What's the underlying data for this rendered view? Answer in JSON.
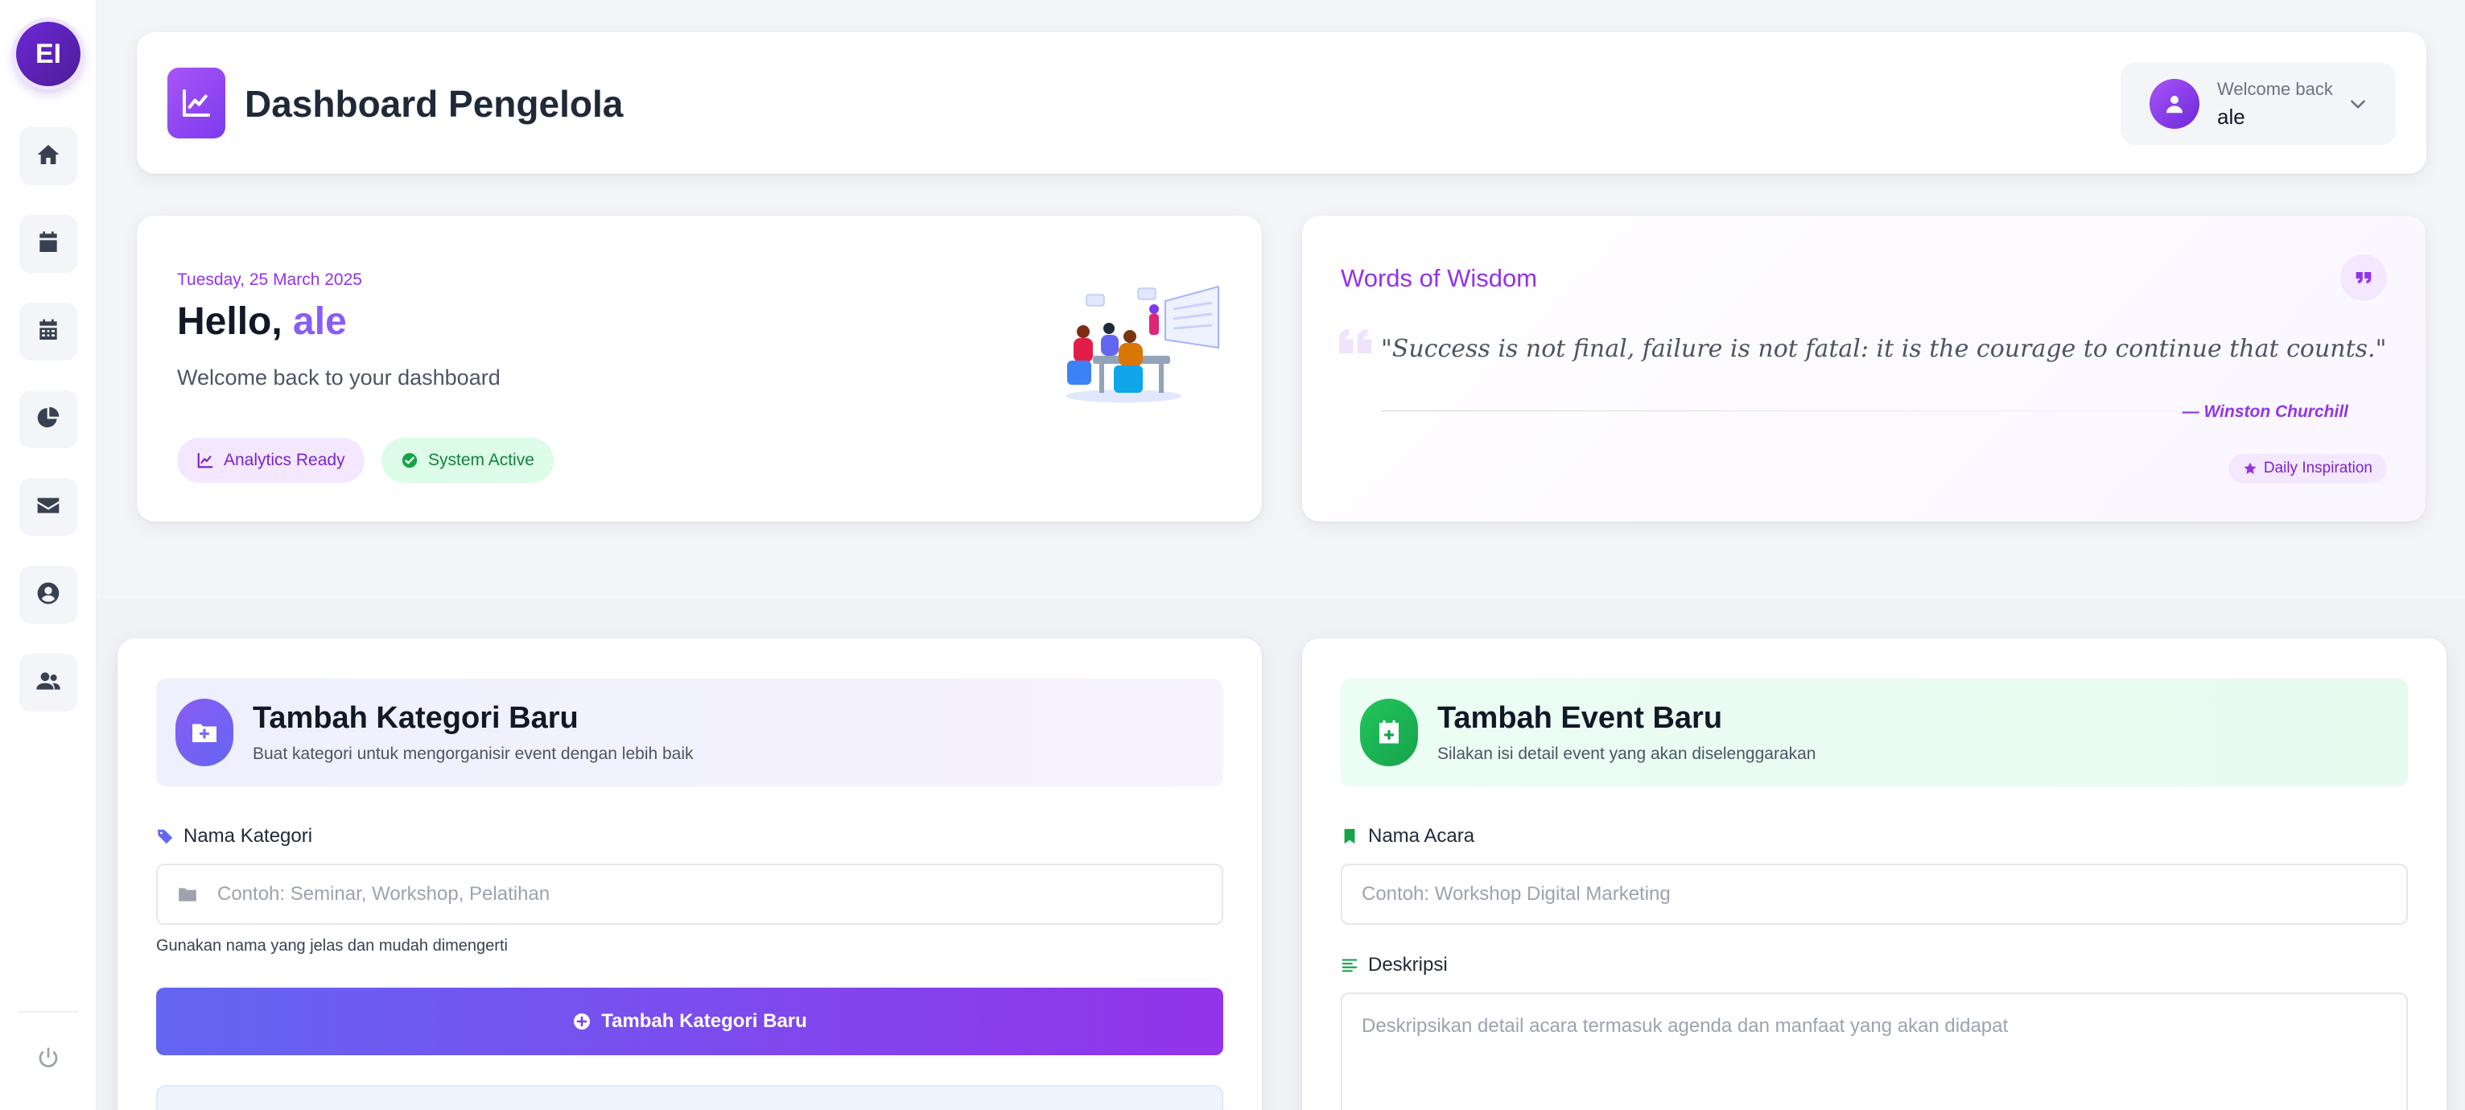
{
  "sidebar": {
    "logo_text": "EI",
    "items": [
      {
        "name": "home",
        "icon": "home-icon"
      },
      {
        "name": "calendar",
        "icon": "calendar-icon"
      },
      {
        "name": "calendar-grid",
        "icon": "calendar-grid-icon"
      },
      {
        "name": "reports",
        "icon": "pie-chart-icon"
      },
      {
        "name": "messages",
        "icon": "envelope-icon"
      },
      {
        "name": "profile",
        "icon": "user-circle-icon"
      },
      {
        "name": "users",
        "icon": "users-icon"
      }
    ],
    "logout_icon": "power-icon"
  },
  "header": {
    "title": "Dashboard Pengelola",
    "welcome_label": "Welcome back",
    "username": "ale"
  },
  "hello_card": {
    "date": "Tuesday, 25 March 2025",
    "greeting": "Hello,",
    "name": "ale",
    "subtitle": "Welcome back to your dashboard",
    "badges": [
      "Analytics Ready",
      "System Active"
    ]
  },
  "wisdom": {
    "title": "Words of Wisdom",
    "quote": "\"Success is not final, failure is not fatal: it is the courage to continue that counts.\"",
    "author": "— Winston Churchill",
    "badge": "Daily Inspiration"
  },
  "category_form": {
    "title": "Tambah Kategori Baru",
    "subtitle": "Buat kategori untuk mengorganisir event dengan lebih baik",
    "field_label": "Nama Kategori",
    "placeholder": "Contoh: Seminar, Workshop, Pelatihan",
    "hint": "Gunakan nama yang jelas dan mudah dimengerti",
    "submit_label": "Tambah Kategori Baru"
  },
  "event_form": {
    "title": "Tambah Event Baru",
    "subtitle": "Silakan isi detail event yang akan diselenggarakan",
    "name_label": "Nama Acara",
    "name_placeholder": "Contoh: Workshop Digital Marketing",
    "desc_label": "Deskripsi",
    "desc_placeholder": "Deskripsikan detail acara termasuk agenda dan manfaat yang akan didapat"
  },
  "colors": {
    "accent": "#8b5cf6",
    "accent_dark": "#6d28d9",
    "success": "#22c55e",
    "background": "#f4f5f8"
  }
}
